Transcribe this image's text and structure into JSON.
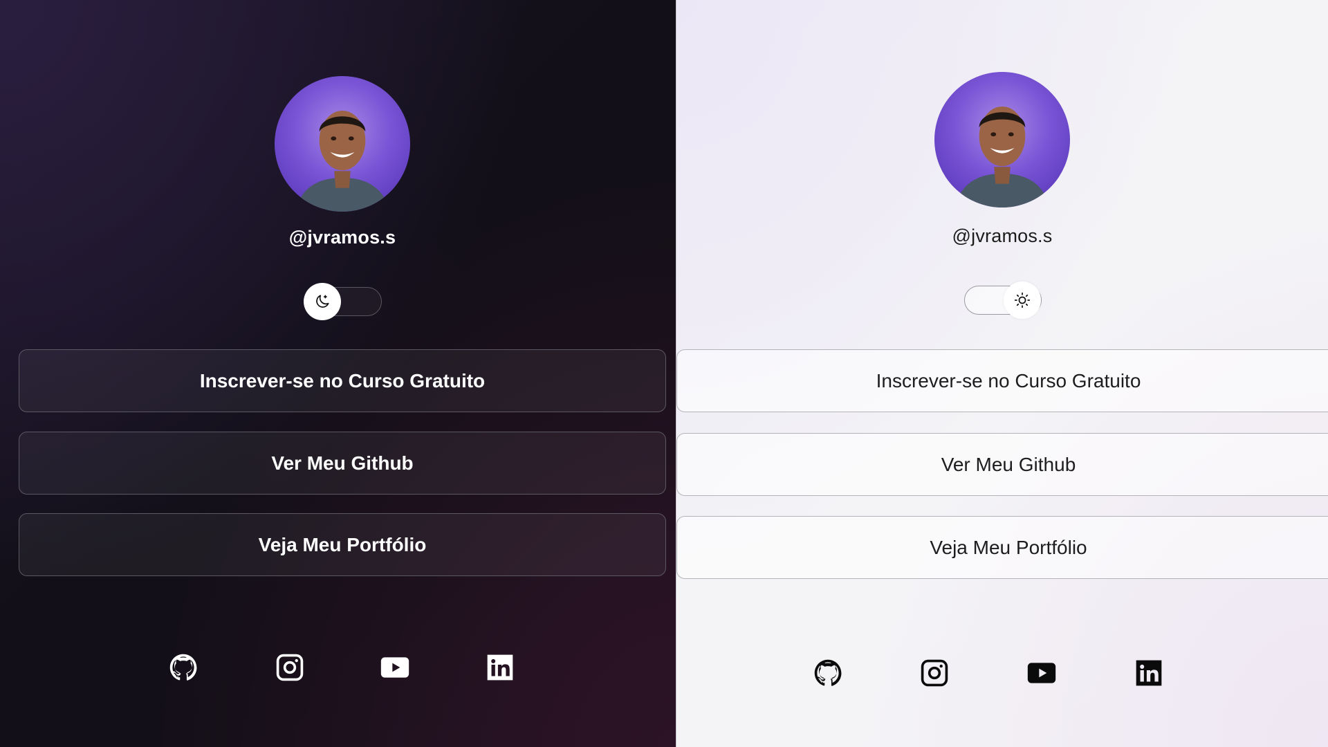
{
  "dark_theme": {
    "handle": "@jvramos.s",
    "theme_toggle": {
      "state": "dark",
      "icon": "moon-icon"
    },
    "buttons": [
      "Inscrever-se no Curso Gratuito",
      "Ver Meu Github",
      "Veja Meu Portfólio"
    ],
    "social_icons": [
      "github-icon",
      "instagram-icon",
      "youtube-icon",
      "linkedin-icon"
    ]
  },
  "light_theme": {
    "handle": "@jvramos.s",
    "theme_toggle": {
      "state": "light",
      "icon": "sun-icon"
    },
    "buttons": [
      "Inscrever-se no Curso Gratuito",
      "Ver Meu Github",
      "Veja Meu Portfólio"
    ],
    "social_icons": [
      "github-icon",
      "instagram-icon",
      "youtube-icon",
      "linkedin-icon"
    ]
  },
  "colors": {
    "dark_background": "#120f18",
    "light_background": "#f3f2f6",
    "avatar_accent": "#7a55d6"
  }
}
